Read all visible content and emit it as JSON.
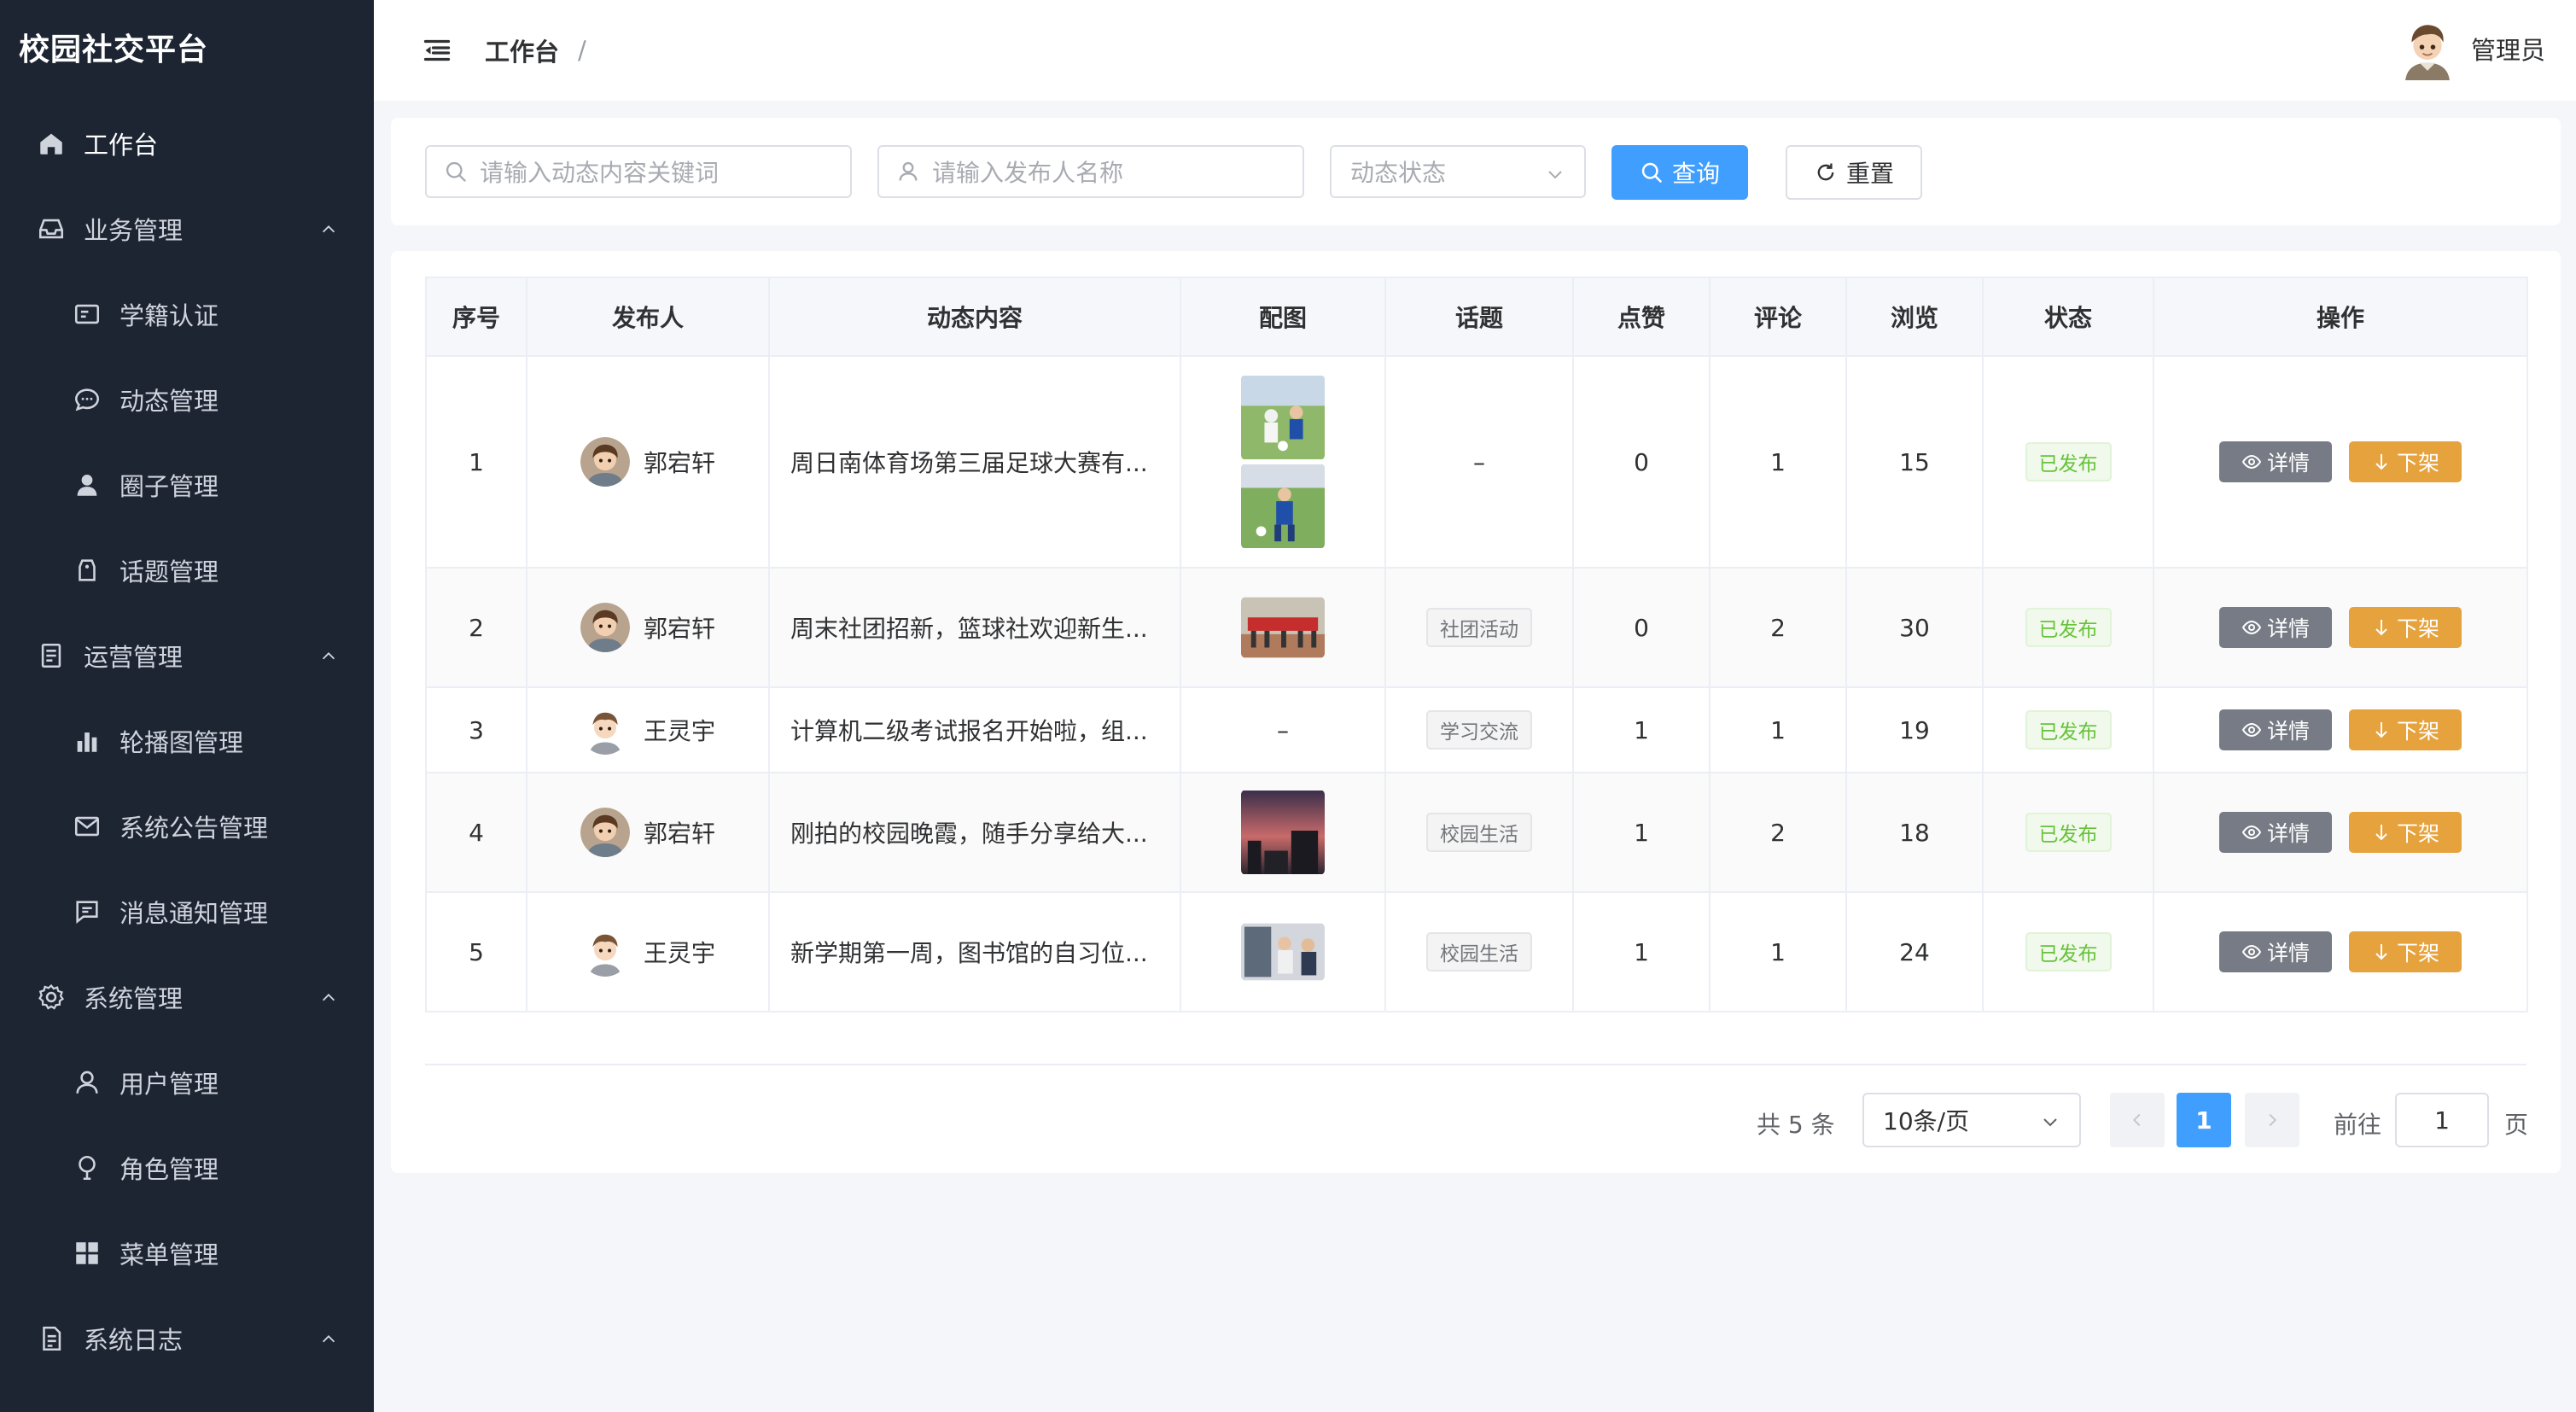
{
  "app": {
    "title": "校园社交平台"
  },
  "sidebar": {
    "items": [
      {
        "label": "工作台",
        "icon": "home-icon",
        "level": "top",
        "caret": false
      },
      {
        "label": "业务管理",
        "icon": "inbox-icon",
        "level": "top",
        "caret": true
      },
      {
        "label": "学籍认证",
        "icon": "id-card-icon",
        "level": "sub"
      },
      {
        "label": "动态管理",
        "icon": "chat-bubble-icon",
        "level": "sub"
      },
      {
        "label": "圈子管理",
        "icon": "user-filled-icon",
        "level": "sub"
      },
      {
        "label": "话题管理",
        "icon": "tag-icon",
        "level": "sub"
      },
      {
        "label": "运营管理",
        "icon": "document-icon",
        "level": "top",
        "caret": true
      },
      {
        "label": "轮播图管理",
        "icon": "bar-chart-icon",
        "level": "sub"
      },
      {
        "label": "系统公告管理",
        "icon": "envelope-icon",
        "level": "sub"
      },
      {
        "label": "消息通知管理",
        "icon": "message-icon",
        "level": "sub"
      },
      {
        "label": "系统管理",
        "icon": "gear-icon",
        "level": "top",
        "caret": true
      },
      {
        "label": "用户管理",
        "icon": "user-icon",
        "level": "sub"
      },
      {
        "label": "角色管理",
        "icon": "bulb-icon",
        "level": "sub"
      },
      {
        "label": "菜单管理",
        "icon": "grid-icon",
        "level": "sub"
      },
      {
        "label": "系统日志",
        "icon": "log-file-icon",
        "level": "top",
        "caret": true
      }
    ]
  },
  "header": {
    "breadcrumb": "工作台",
    "separator": "/",
    "user_name": "管理员"
  },
  "filters": {
    "keyword_placeholder": "请输入动态内容关键词",
    "publisher_placeholder": "请输入发布人名称",
    "status_placeholder": "动态状态",
    "query_label": "查询",
    "reset_label": "重置"
  },
  "table": {
    "columns": [
      "序号",
      "发布人",
      "动态内容",
      "配图",
      "话题",
      "点赞",
      "评论",
      "浏览",
      "状态",
      "操作"
    ],
    "rows": [
      {
        "index": "1",
        "publisher": "郭宕轩",
        "avatar": "boy-brown",
        "content": "周日南体育场第三届足球大赛有...",
        "images": [
          "soccer-a",
          "soccer-b"
        ],
        "topic": "–",
        "likes": "0",
        "comments": "1",
        "views": "15",
        "status": "已发布"
      },
      {
        "index": "2",
        "publisher": "郭宕轩",
        "avatar": "boy-brown",
        "content": "周末社团招新，篮球社欢迎新生...",
        "images": [
          "club-fair"
        ],
        "topic": "社团活动",
        "likes": "0",
        "comments": "2",
        "views": "30",
        "status": "已发布"
      },
      {
        "index": "3",
        "publisher": "王灵宇",
        "avatar": "boy-cartoon",
        "content": "计算机二级考试报名开始啦，组...",
        "images": [],
        "topic": "学习交流",
        "likes": "1",
        "comments": "1",
        "views": "19",
        "status": "已发布"
      },
      {
        "index": "4",
        "publisher": "郭宕轩",
        "avatar": "boy-brown",
        "content": "刚拍的校园晚霞，随手分享给大...",
        "images": [
          "sunset"
        ],
        "topic": "校园生活",
        "likes": "1",
        "comments": "2",
        "views": "18",
        "status": "已发布"
      },
      {
        "index": "5",
        "publisher": "王灵宇",
        "avatar": "boy-cartoon",
        "content": "新学期第一周，图书馆的自习位...",
        "images": [
          "library"
        ],
        "topic": "校园生活",
        "likes": "1",
        "comments": "1",
        "views": "24",
        "status": "已发布"
      }
    ],
    "empty_mark": "–",
    "detail_label": "详情",
    "offline_label": "下架"
  },
  "pagination": {
    "total_text": "共 5 条",
    "page_size": "10条/页",
    "current_page": "1",
    "goto_label": "前往",
    "goto_value": "1",
    "page_unit": "页"
  },
  "colors": {
    "sidebar_bg": "#1d2533",
    "primary": "#409eff",
    "warning": "#e6a23c",
    "info": "#767b85",
    "success": "#67c23a"
  }
}
